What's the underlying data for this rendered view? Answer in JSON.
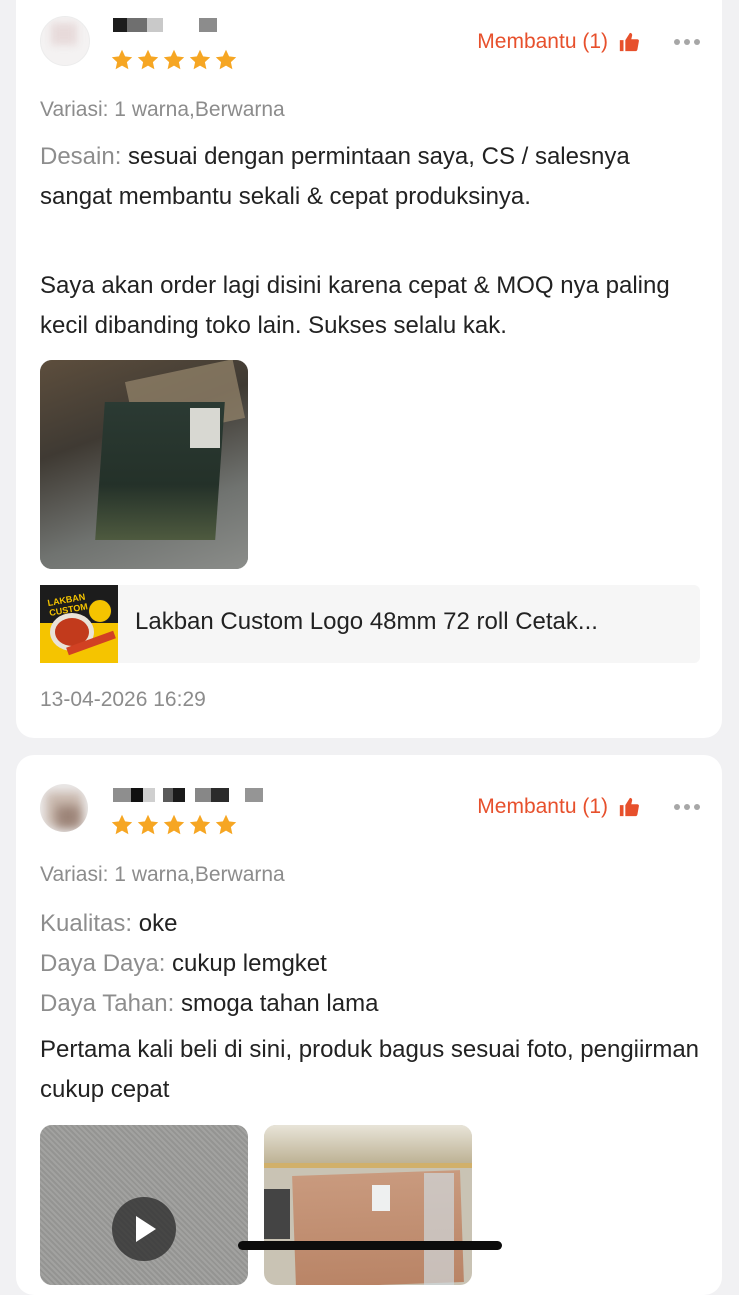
{
  "colors": {
    "accent": "#e7502c",
    "star": "#f6a623",
    "muted": "#8c8c8c"
  },
  "reviews": [
    {
      "avatar_icon": "user-avatar",
      "rating": 5,
      "helpful_label": "Membantu (1)",
      "variant": "Variasi: 1 warna,Berwarna",
      "attributes": [
        {
          "label": "Desain:",
          "value": " sesuai dengan permintaan saya, CS / salesnya sangat membantu sekali & cepat produksinya."
        }
      ],
      "comment": "Saya akan order lagi disini karena cepat & MOQ nya paling kecil dibanding toko lain. Sukses selalu kak.",
      "product_name": "Lakban Custom Logo 48mm 72 roll Cetak...",
      "product_thumb_text": "LAKBAN CUSTOM",
      "date": "13-04-2026 16:29"
    },
    {
      "avatar_icon": "user-avatar",
      "rating": 5,
      "helpful_label": "Membantu (1)",
      "variant": "Variasi: 1 warna,Berwarna",
      "attributes": [
        {
          "label": "Kualitas:",
          "value": " oke"
        },
        {
          "label": "Daya Daya:",
          "value": " cukup lemgket"
        },
        {
          "label": "Daya Tahan:",
          "value": " smoga tahan lama"
        }
      ],
      "comment": "Pertama kali beli di sini, produk bagus sesuai foto, pengiirman cukup cepat"
    }
  ],
  "icons": {
    "thumb": "thumbs-up-icon",
    "more": "more-dots-icon",
    "play": "play-icon",
    "star": "star-icon"
  }
}
